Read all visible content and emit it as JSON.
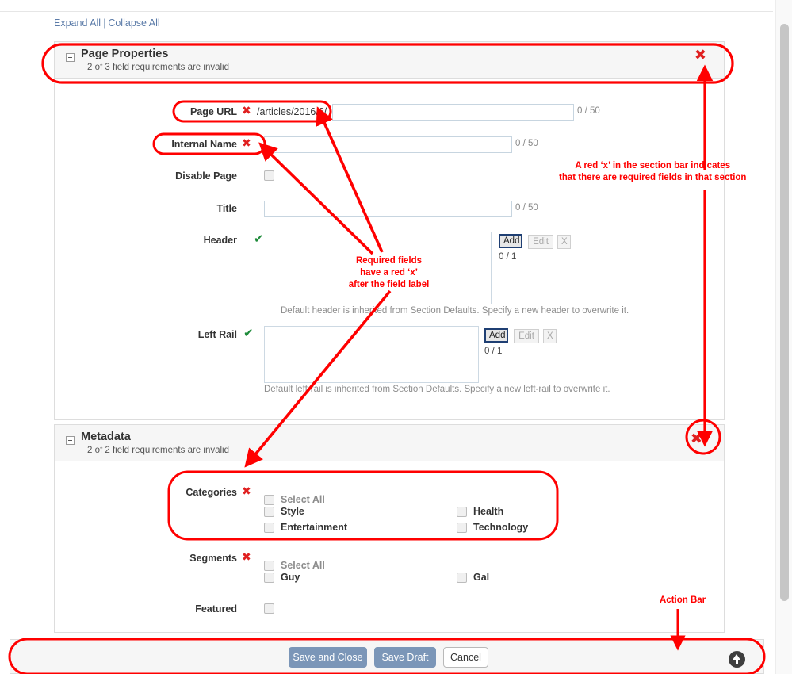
{
  "toplinks": {
    "expand": "Expand All",
    "separator": "|",
    "collapse": "Collapse All"
  },
  "sections": [
    {
      "title": "Page Properties",
      "subtitle": "2 of 3 field requirements are invalid",
      "status_icon": "red-x",
      "fields": [
        {
          "label": "Page URL",
          "marker": "red-x",
          "prefix": "/articles/2016/6/",
          "value": "",
          "counter": "0 / 50"
        },
        {
          "label": "Internal Name",
          "marker": "red-x",
          "value": "",
          "counter": "0 / 50"
        },
        {
          "label": "Disable Page",
          "marker": "none",
          "checked": false
        },
        {
          "label": "Title",
          "marker": "none",
          "value": "",
          "counter": "0 / 50"
        },
        {
          "label": "Header",
          "marker": "green-check",
          "counter": "0 / 1",
          "buttons": [
            "Add",
            "Edit",
            "X"
          ],
          "help": "Default header is inherited from Section Defaults. Specify a new header to overwrite it."
        },
        {
          "label": "Left Rail",
          "marker": "green-check",
          "counter": "0 / 1",
          "buttons": [
            "Add",
            "Edit",
            "X"
          ],
          "help": "Default left-rail is inherited from Section Defaults. Specify a new left-rail to overwrite it."
        }
      ]
    },
    {
      "title": "Metadata",
      "subtitle": "2 of 2 field requirements are invalid",
      "status_icon": "red-x",
      "fields": [
        {
          "label": "Categories",
          "marker": "red-x",
          "select_all": "Select All",
          "options_left": [
            "Style",
            "Entertainment"
          ],
          "options_right": [
            "Health",
            "Technology"
          ]
        },
        {
          "label": "Segments",
          "marker": "red-x",
          "select_all": "Select All",
          "options_left": [
            "Guy"
          ],
          "options_right": [
            "Gal"
          ]
        },
        {
          "label": "Featured",
          "marker": "none",
          "checked": false
        }
      ]
    }
  ],
  "action_bar": {
    "save_and_close": "Save and Close",
    "save_draft": "Save Draft",
    "cancel": "Cancel",
    "scroll_top_icon": "up-arrow-icon"
  },
  "annotations": {
    "section_bar_note_line1": "A red ‘x’ in the section bar indicates",
    "section_bar_note_line2": "that there are required fields in that section",
    "required_note_line1": "Required fields",
    "required_note_line2": "have a red ‘x’",
    "required_note_line3": "after the field label",
    "action_bar_label": "Action Bar",
    "color": "#ff0000"
  },
  "colors": {
    "annotation_red": "#ff0000",
    "error_red": "#e02020",
    "valid_green": "#1e8b3a",
    "link_blue": "#5b7ba8",
    "button_blue": "#7b96b8"
  }
}
